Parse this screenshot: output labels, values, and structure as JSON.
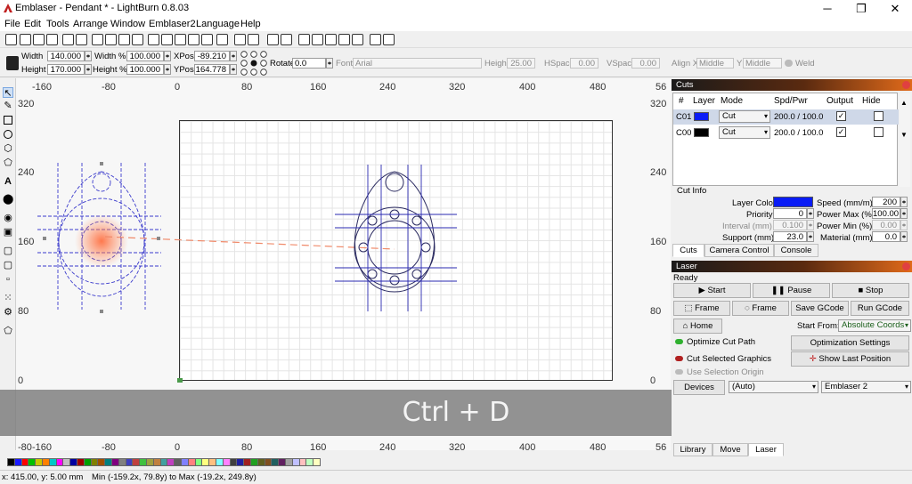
{
  "window": {
    "title": "Emblaser - Pendant * - LightBurn 0.8.03",
    "minimize": "─",
    "maximize": "❐",
    "close": "✕"
  },
  "menu": [
    "File",
    "Edit",
    "Tools",
    "Arrange",
    "Window",
    "Emblaser2",
    "Language",
    "Help"
  ],
  "toolbar_icons": [
    "new-file-icon",
    "open-file-icon",
    "save-file-icon",
    "save-as-icon",
    "import-icon",
    "export-icon",
    "copy-icon",
    "paste-icon",
    "cut-icon",
    "delete-icon",
    "move-icon",
    "zoom-in-icon",
    "zoom-out-icon",
    "zoom-fit-icon",
    "zoom-selection-icon",
    "frame-icon",
    "settings-icon",
    "tools-icon",
    "group-icon",
    "ungroup-icon",
    "align-left-icon",
    "align-center-icon",
    "align-right-icon",
    "flip-horizontal-icon",
    "flip-vertical-icon",
    "distribute-icon",
    "snap-icon"
  ],
  "props": {
    "width_label": "Width",
    "width": "140.000",
    "height_label": "Height",
    "height": "170.000",
    "width_pct_label": "Width %",
    "width_pct": "100.000",
    "height_pct_label": "Height %",
    "height_pct": "100.000",
    "xpos_label": "XPos",
    "xpos": "-89.210",
    "ypos_label": "YPos",
    "ypos": "164.778",
    "rotate_label": "Rotate",
    "rotate": "0.0",
    "font_label": "Font",
    "font": "Arial",
    "fheight_label": "Height",
    "fheight": "25.00",
    "hspace_label": "HSpace",
    "hspace": "0.00",
    "vspace_label": "VSpace",
    "vspace": "0.00",
    "alignx_label": "Align X",
    "alignx": "Middle",
    "aligny_label": "Y",
    "aligny": "Middle",
    "weld_label": "Weld"
  },
  "ruler": {
    "top": [
      "-160",
      "-80",
      "0",
      "80",
      "160",
      "240",
      "320",
      "400",
      "480",
      "56"
    ],
    "left": [
      "320",
      "240",
      "160",
      "80",
      "0"
    ],
    "right": [
      "320",
      "240",
      "160",
      "80",
      "0"
    ],
    "bottom": [
      "-80",
      "-160",
      "-80",
      "0",
      "80",
      "160",
      "240",
      "320",
      "400",
      "480",
      "56"
    ]
  },
  "overlay_text": "Ctrl + D",
  "cuts_panel": {
    "title": "Cuts",
    "headers": [
      "#",
      "Layer",
      "Mode",
      "Spd/Pwr",
      "Output",
      "Hide"
    ],
    "rows": [
      {
        "id": "C01",
        "color": "#0a1cf5",
        "mode": "Cut",
        "spdpwr": "200.0 / 100.0",
        "output": "✓",
        "hide": ""
      },
      {
        "id": "C00",
        "color": "#000000",
        "mode": "Cut",
        "spdpwr": "200.0 / 100.0",
        "output": "✓",
        "hide": ""
      }
    ],
    "cut_info_title": "Cut Info",
    "layer_color_label": "Layer Color",
    "layer_color": "#0a1cf5",
    "priority_label": "Priority",
    "priority": "0",
    "interval_label": "Interval (mm)",
    "interval": "0.100",
    "support_label": "Support (mm)",
    "support": "23.0",
    "speed_label": "Speed (mm/m)",
    "speed": "200",
    "power_max_label": "Power Max (%)",
    "power_max": "100.00",
    "power_min_label": "Power Min (%)",
    "power_min": "0.00",
    "material_label": "Material (mm)",
    "material": "0.0",
    "tabs": [
      "Cuts",
      "Camera Control",
      "Console"
    ]
  },
  "laser_panel": {
    "title": "Laser",
    "status": "Ready",
    "start": "Start",
    "pause": "Pause",
    "stop": "Stop",
    "frame1": "Frame",
    "frame2": "Frame",
    "save_gcode": "Save GCode",
    "run_gcode": "Run GCode",
    "home": "Home",
    "start_from_label": "Start From:",
    "start_from": "Absolute Coords",
    "optimize_cut_path": "Optimize Cut Path",
    "optimization_settings": "Optimization Settings",
    "cut_selected": "Cut Selected Graphics",
    "show_last_position": "Show Last Position",
    "use_selection_origin": "Use Selection Origin",
    "devices": "Devices",
    "device_port": "(Auto)",
    "device": "Emblaser 2",
    "tabs": [
      "Library",
      "Move",
      "Laser"
    ]
  },
  "palette": [
    "#000000",
    "#1a1aff",
    "#ff0000",
    "#00c000",
    "#c8c800",
    "#ff8000",
    "#00c8c8",
    "#ff00ff",
    "#c0c0c0",
    "#0000a0",
    "#a00000",
    "#00a000",
    "#808000",
    "#a05000",
    "#008080",
    "#800080",
    "#808080",
    "#4040c0",
    "#c04040",
    "#40c040",
    "#a0a040",
    "#c08040",
    "#40a0a0",
    "#c040c0",
    "#606060",
    "#8080ff",
    "#ff8080",
    "#80ff80",
    "#ffff80",
    "#ffc080",
    "#80ffff",
    "#ff80ff",
    "#404040",
    "#2020a0",
    "#a02020",
    "#20a020",
    "#606020",
    "#805020",
    "#206060",
    "#602060",
    "#a0a0a0",
    "#c0c0ff",
    "#ffc0c0",
    "#c0ffc0",
    "#ffffc0"
  ],
  "status": {
    "coords": "x: 415.00, y: 5.00 mm",
    "bounds": "Min (-159.2x, 79.8y) to Max (-19.2x, 249.8y)"
  }
}
